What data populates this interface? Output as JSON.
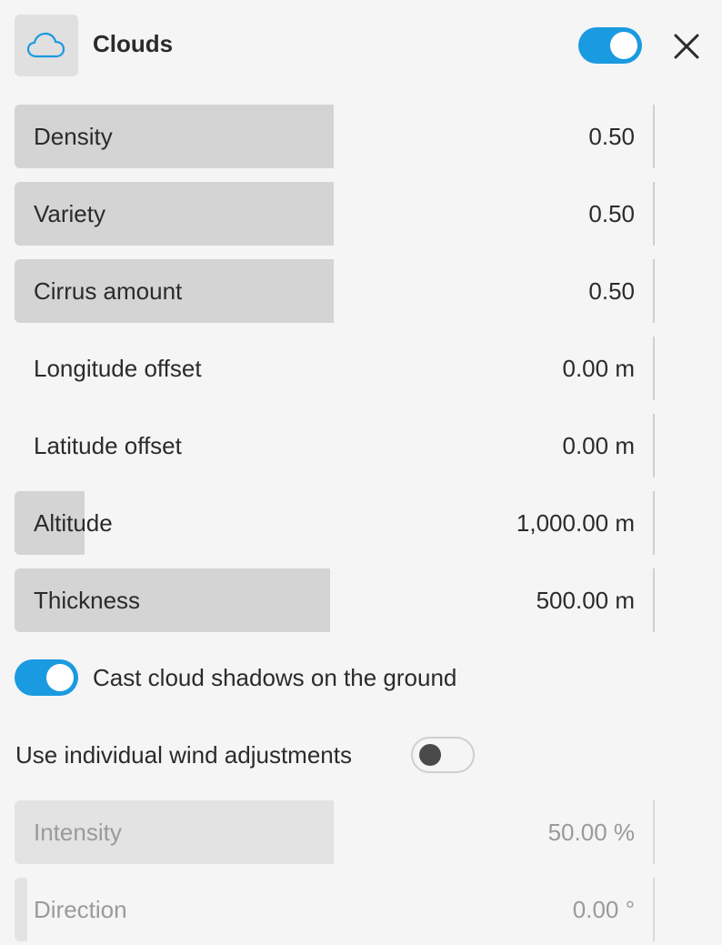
{
  "header": {
    "title": "Clouds",
    "icon": "cloud-icon",
    "enabled": true,
    "close_icon": "close-icon"
  },
  "colors": {
    "accent": "#1a9ae0",
    "fill": "#d4d4d4",
    "disabled_text": "#9a9a9a",
    "background": "#f5f5f5"
  },
  "sliders": [
    {
      "label": "Density",
      "value": "0.50",
      "level": 0.5
    },
    {
      "label": "Variety",
      "value": "0.50",
      "level": 0.5
    },
    {
      "label": "Cirrus amount",
      "value": "0.50",
      "level": 0.5
    },
    {
      "label": "Longitude offset",
      "value": "0.00 m",
      "level": 0
    },
    {
      "label": "Latitude offset",
      "value": "0.00 m",
      "level": 0
    },
    {
      "label": "Altitude",
      "value": "1,000.00 m",
      "level": 0.11
    },
    {
      "label": "Thickness",
      "value": "500.00 m",
      "level": 0.495
    }
  ],
  "cast_shadows": {
    "label": "Cast cloud shadows on the ground",
    "enabled": true
  },
  "wind": {
    "label": "Use individual wind adjustments",
    "enabled": false
  },
  "wind_sliders": [
    {
      "label": "Intensity",
      "value": "50.00 %",
      "level": 0.5
    },
    {
      "label": "Direction",
      "value": "0.00 °",
      "level": 0.02
    }
  ]
}
